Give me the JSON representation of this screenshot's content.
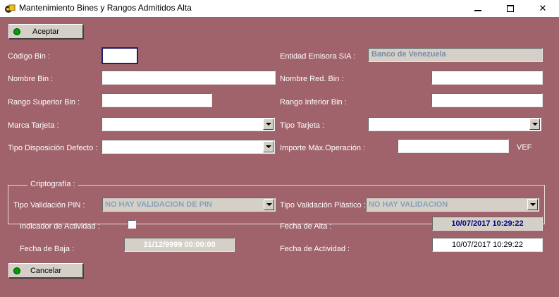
{
  "window": {
    "title": "Mantenimiento Bines y Rangos Admitidos Alta"
  },
  "buttons": {
    "aceptar": "Aceptar",
    "cancelar": "Cancelar"
  },
  "labels": {
    "codigo_bin": "Código Bin :",
    "entidad_emisora": "Entidad Emisora SIA :",
    "nombre_bin": "Nombre Bin :",
    "nombre_red_bin": "Nombre Red. Bin :",
    "rango_superior": "Rango Superior Bin :",
    "rango_inferior": "Rango Inferior Bin :",
    "marca_tarjeta": "Marca Tarjeta :",
    "tipo_tarjeta": "Tipo Tarjeta :",
    "tipo_disposicion": "Tipo Disposición Defecto :",
    "importe_max": "Importe Máx.Operación :",
    "currency": "VEF",
    "criptografia": "Criptografía :",
    "tipo_validacion_pin": "Tipo Validación PIN :",
    "tipo_validacion_plastico": "Tipo Validación Plástico :",
    "indicador_actividad": "Indicador de Actividad :",
    "fecha_alta": "Fecha de Alta :",
    "fecha_baja": "Fecha de Baja :",
    "fecha_actividad": "Fecha de Actividad :"
  },
  "values": {
    "codigo_bin": "",
    "entidad_emisora": "Banco de Venezuela",
    "nombre_bin": "",
    "nombre_red_bin": "",
    "rango_superior": "",
    "rango_inferior": "",
    "marca_tarjeta": "",
    "tipo_tarjeta": "",
    "tipo_disposicion": "",
    "importe_max": "",
    "tipo_validacion_pin": "NO HAY VALIDACION DE PIN",
    "tipo_validacion_plastico": "NO HAY VALIDACION",
    "indicador_actividad": false,
    "fecha_alta": "10/07/2017 10:29:22",
    "fecha_baja": "31/12/9999 00:00:00",
    "fecha_actividad": "10/07/2017 10:29:22"
  },
  "icons": {
    "app": "app-icon",
    "minimize": "minimize-icon",
    "maximize": "maximize-icon",
    "close": "close-icon",
    "aceptar": "green-dot-icon",
    "cancelar": "green-dot-icon"
  },
  "colors": {
    "client_bg": "#a0636b",
    "button_dot": "#00a000",
    "date_alta_bg": "#d4d0c8",
    "date_alta_text": "#000080"
  }
}
